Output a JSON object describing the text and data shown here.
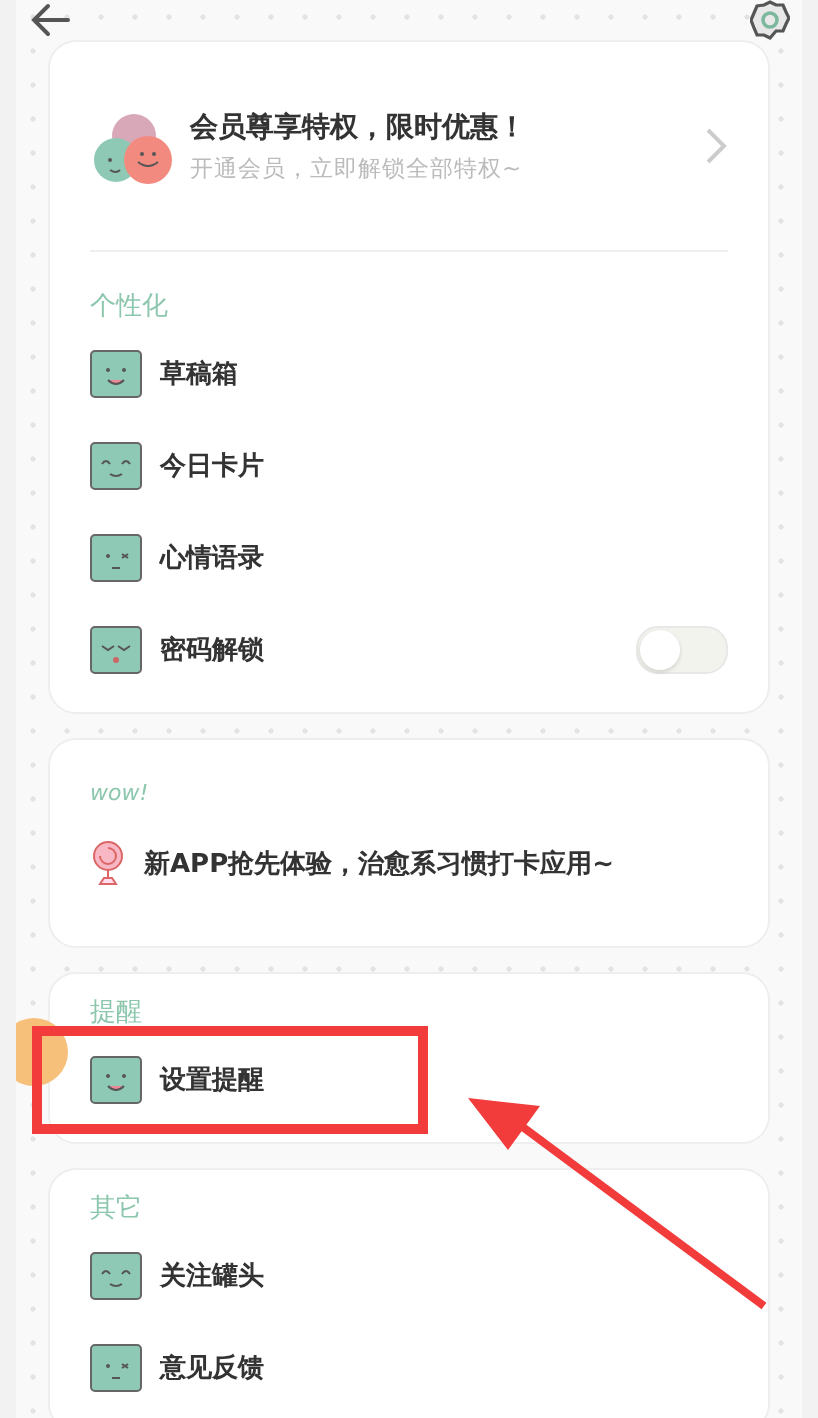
{
  "member": {
    "title": "会员尊享特权，限时优惠！",
    "subtitle": "开通会员，立即解锁全部特权~"
  },
  "sections": [
    {
      "kind": "list",
      "title": "个性化",
      "items": [
        {
          "label": "草稿箱",
          "kind": "link"
        },
        {
          "label": "今日卡片",
          "kind": "link"
        },
        {
          "label": "心情语录",
          "kind": "link"
        },
        {
          "label": "密码解锁",
          "kind": "toggle",
          "on": false
        }
      ]
    },
    {
      "kind": "promo",
      "tag": "wow!",
      "text": "新APP抢先体验，治愈系习惯打卡应用~"
    },
    {
      "kind": "list",
      "title": "提醒",
      "items": [
        {
          "label": "设置提醒",
          "kind": "link"
        }
      ]
    },
    {
      "kind": "list",
      "title": "其它",
      "items": [
        {
          "label": "关注罐头",
          "kind": "link"
        },
        {
          "label": "意见反馈",
          "kind": "link"
        }
      ]
    }
  ]
}
